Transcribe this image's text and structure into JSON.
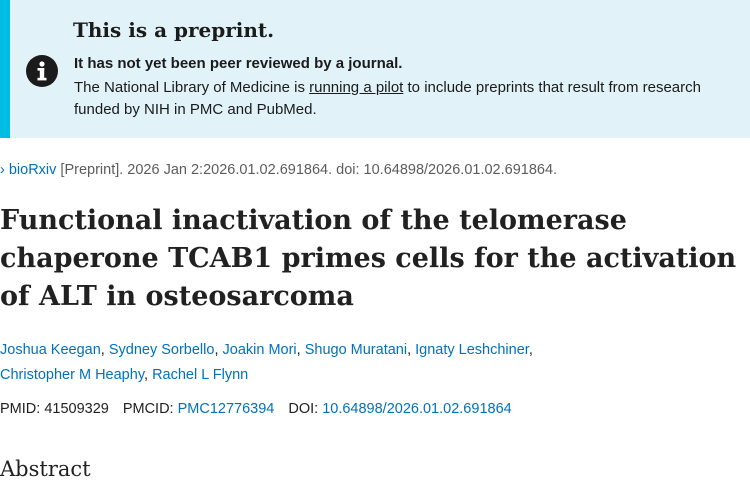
{
  "banner": {
    "title": "This is a preprint.",
    "bold_text": "It has not yet been peer reviewed by a journal.",
    "desc_before": "The National Library of Medicine is ",
    "desc_link": "running a pilot",
    "desc_after": " to include preprints that result from research funded by NIH in PMC and PubMed.",
    "icon": "info-circle-icon"
  },
  "citation": {
    "chevron": "›",
    "source": "bioRxiv",
    "rest": " [Preprint]. 2026 Jan 2:2026.01.02.691864. doi: 10.64898/2026.01.02.691864."
  },
  "article": {
    "title": "Functional inactivation of the telomerase chaperone TCAB1 primes cells for the activation of ALT in osteosarcoma"
  },
  "authors": [
    "Joshua Keegan",
    "Sydney Sorbello",
    "Joakin Mori",
    "Shugo Muratani",
    "Ignaty Leshchiner",
    "Christopher M Heaphy",
    "Rachel L Flynn"
  ],
  "separator": ", ",
  "ids": {
    "pmid_label": "PMID: ",
    "pmid": "41509329",
    "pmcid_label": "PMCID: ",
    "pmcid": "PMC12776394",
    "doi_label": "DOI: ",
    "doi": "10.64898/2026.01.02.691864"
  },
  "abstract": {
    "heading": "Abstract"
  },
  "colors": {
    "banner_bg": "#e1f3f8",
    "banner_accent": "#00bde3",
    "link": "#0071bc"
  }
}
